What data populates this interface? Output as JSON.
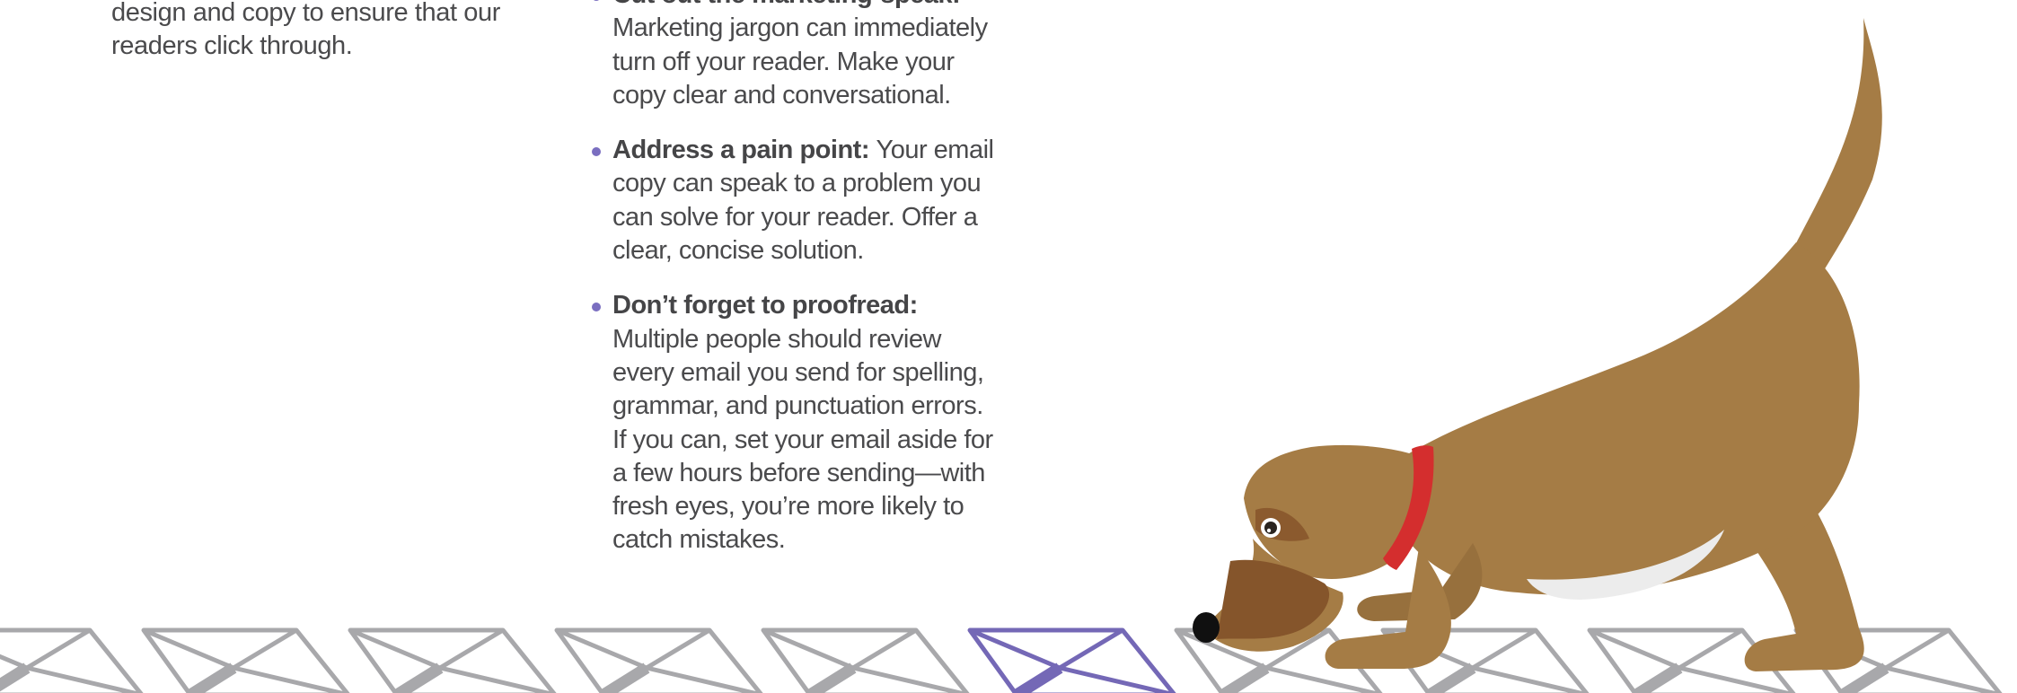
{
  "intro": {
    "tail_text": "design and copy to ensure that our readers click through."
  },
  "tips": [
    {
      "title": "Cut out the marketing-speak:",
      "body": "Marketing jargon can immediately turn off your reader. Make your copy clear and conversational."
    },
    {
      "title": "Address a pain point:",
      "body": "Your email copy can speak to a problem you can solve for your reader. Offer a clear, concise solution."
    },
    {
      "title": "Don’t forget to proofread:",
      "body": "Multiple people should review every email you send for spelling, grammar, and punctuation errors. If you can, set your email aside for a few hours before sending—with fresh eyes, you’re more likely to catch mistakes."
    }
  ],
  "illustration": {
    "subject": "dog-sniffing-envelope",
    "colors": {
      "dog_fur": "#a57c45",
      "dog_ear": "#85552b",
      "collar": "#d42e2e",
      "belly": "#ececec",
      "envelope_gray": "#a8a8ab",
      "envelope_highlight": "#7468b6",
      "bullet": "#7a6ec0",
      "text": "#4a4a4c"
    }
  }
}
